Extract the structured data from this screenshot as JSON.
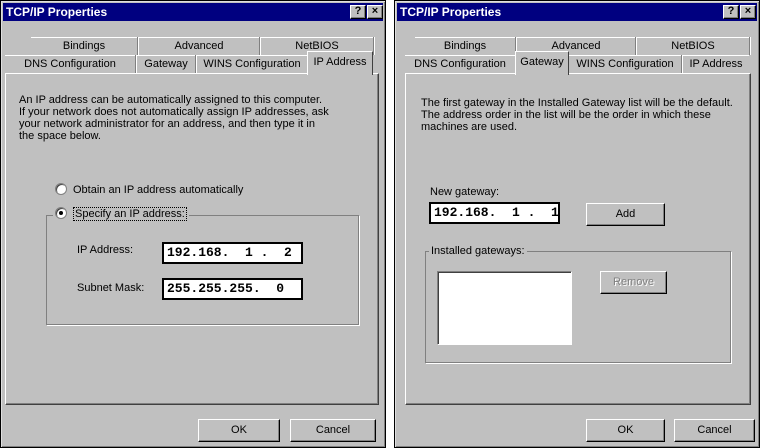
{
  "dialogs": [
    {
      "title": "TCP/IP Properties",
      "help_button": "?",
      "close_button": "×",
      "tabs_back": [
        "Bindings",
        "Advanced",
        "NetBIOS"
      ],
      "tabs_front": [
        "DNS Configuration",
        "Gateway",
        "WINS Configuration",
        "IP Address"
      ],
      "active_tab": "IP Address",
      "description": [
        "An IP address can be automatically assigned to this computer.",
        "If your network does not automatically assign IP addresses, ask",
        "your network administrator for an address, and then type it in",
        "the space below."
      ],
      "radio_auto": {
        "label": "Obtain an IP address automatically",
        "selected": false
      },
      "radio_specify": {
        "label": "Specify an IP address:",
        "selected": true
      },
      "ip_address_label": "IP Address:",
      "ip_address_value": "192.168.  1 .  2",
      "subnet_mask_label": "Subnet Mask:",
      "subnet_mask_value": "255.255.255.  0",
      "ok_label": "OK",
      "cancel_label": "Cancel"
    },
    {
      "title": "TCP/IP Properties",
      "help_button": "?",
      "close_button": "×",
      "tabs_back": [
        "Bindings",
        "Advanced",
        "NetBIOS"
      ],
      "tabs_front": [
        "DNS Configuration",
        "Gateway",
        "WINS Configuration",
        "IP Address"
      ],
      "active_tab": "Gateway",
      "description": [
        "The first gateway in the Installed Gateway list will be the default.",
        "The address order in the list will be the order in which these",
        "machines are used."
      ],
      "new_gateway_label": "New gateway:",
      "new_gateway_value": "192.168.  1 .  1",
      "add_label": "Add",
      "installed_gateways_label": "Installed gateways:",
      "installed_gateways": [],
      "remove_label": "Remove",
      "ok_label": "OK",
      "cancel_label": "Cancel"
    }
  ],
  "colors": {
    "dialog_face": "#c0c0c0",
    "title_bar": "#000080",
    "title_text": "#ffffff"
  }
}
